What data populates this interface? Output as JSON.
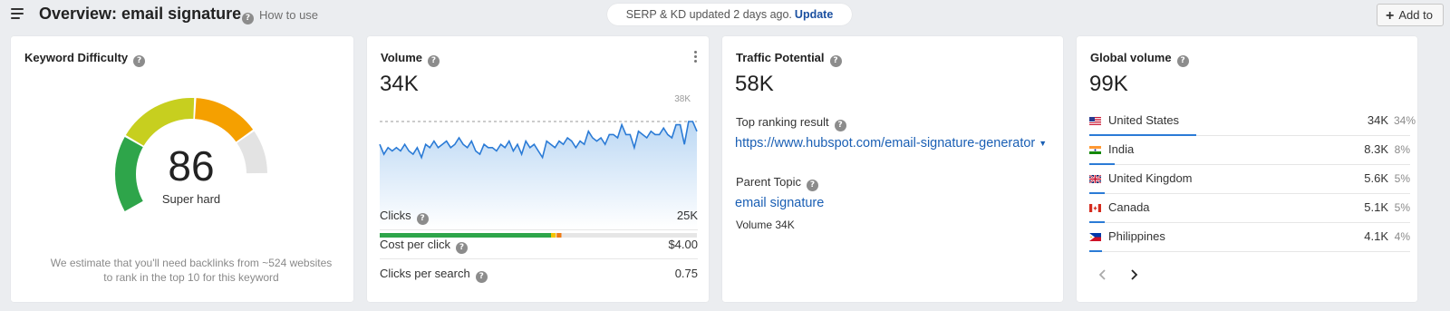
{
  "header": {
    "title": "Overview: email signature",
    "how_to": "How to use",
    "serp_text": "SERP & KD updated 2 days ago.",
    "update_label": "Update",
    "add_to_label": "Add to"
  },
  "kd": {
    "title": "Keyword Difficulty",
    "score": "86",
    "level_value": 86,
    "label": "Super hard",
    "note_line1": "We estimate that you'll need backlinks from ~524 websites",
    "note_line2": "to rank in the top 10 for this keyword"
  },
  "volume": {
    "title": "Volume",
    "value": "34K",
    "chart_max_label": "38K",
    "chart_data": {
      "type": "area",
      "title": "",
      "max_label": "38K",
      "values": [
        27,
        24,
        26,
        25,
        26,
        25,
        27,
        25,
        24,
        26,
        23,
        27,
        26,
        28,
        26,
        27,
        28,
        26,
        27,
        29,
        27,
        26,
        28,
        25,
        24,
        27,
        26,
        26,
        25,
        27,
        26,
        28,
        25,
        27,
        24,
        28,
        26,
        27,
        25,
        23,
        28,
        27,
        26,
        28,
        27,
        29,
        28,
        26,
        28,
        27,
        31,
        29,
        28,
        29,
        27,
        30,
        30,
        29,
        33,
        30,
        30,
        26,
        31,
        30,
        29,
        31,
        30,
        30,
        32,
        30,
        29,
        33,
        33,
        27,
        34,
        34,
        31
      ]
    },
    "click_split": {
      "organic_pct": 54,
      "paid_pct": 1.5,
      "ads_pct": 1.5
    },
    "rows": [
      {
        "label": "Clicks",
        "value": "25K"
      },
      {
        "label": "Cost per click",
        "value": "$4.00"
      },
      {
        "label": "Clicks per search",
        "value": "0.75"
      }
    ]
  },
  "traffic": {
    "title": "Traffic Potential",
    "value": "58K",
    "top_ranking_label": "Top ranking result",
    "top_ranking_url": "https://www.hubspot.com/email-signature-generator",
    "parent_topic_label": "Parent Topic",
    "parent_topic": "email signature",
    "parent_volume": "Volume 34K"
  },
  "global": {
    "title": "Global volume",
    "value": "99K",
    "countries": [
      {
        "name": "United States",
        "volume": "34K",
        "pct": "34%",
        "share": 34,
        "flag": "flag-us"
      },
      {
        "name": "India",
        "volume": "8.3K",
        "pct": "8%",
        "share": 8,
        "flag": "flag-in"
      },
      {
        "name": "United Kingdom",
        "volume": "5.6K",
        "pct": "5%",
        "share": 5,
        "flag": "flag-gb"
      },
      {
        "name": "Canada",
        "volume": "5.1K",
        "pct": "5%",
        "share": 5,
        "flag": "flag-ca"
      },
      {
        "name": "Philippines",
        "volume": "4.1K",
        "pct": "4%",
        "share": 4,
        "flag": "flag-ph"
      }
    ],
    "prev_icon": "chevron-left-icon",
    "next_icon": "chevron-right-icon"
  },
  "colors": {
    "link": "#1a5fb4",
    "line": "#2b7bd6",
    "gauge_green": "#2ea54a",
    "gauge_yellow": "#c7cf1f",
    "gauge_orange": "#f5a000",
    "gauge_rest": "#e3e3e3"
  }
}
